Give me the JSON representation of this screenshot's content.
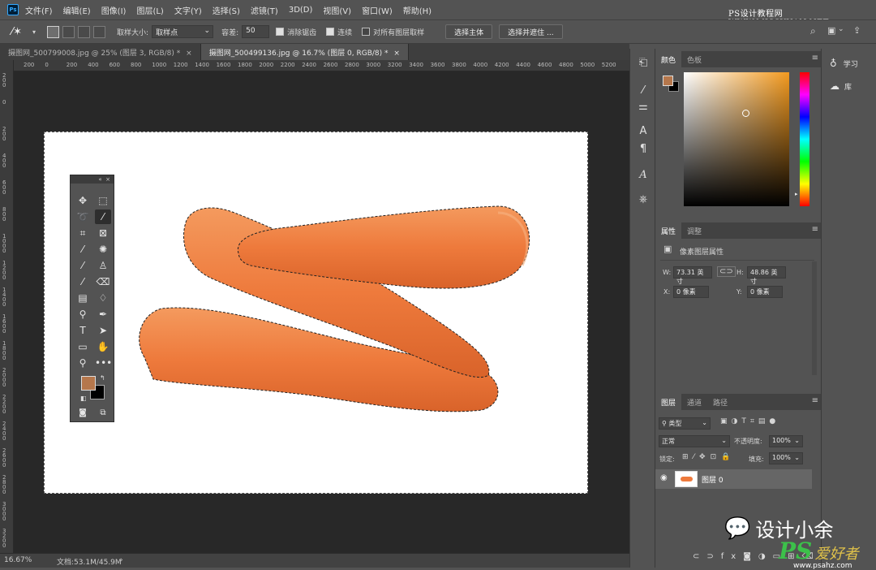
{
  "menubar": {
    "app_logo": "Ps",
    "items": [
      "文件(F)",
      "编辑(E)",
      "图像(I)",
      "图层(L)",
      "文字(Y)",
      "选择(S)",
      "滤镜(T)",
      "3D(D)",
      "视图(V)",
      "窗口(W)",
      "帮助(H)"
    ],
    "watermark": "PS设计教程网 WWW.MISSYUAN.NET"
  },
  "options": {
    "sample_size_label": "取样大小:",
    "sample_size_value": "取样点",
    "tolerance_label": "容差:",
    "tolerance_value": "50",
    "antialias_label": "消除锯齿",
    "contiguous_label": "连续",
    "all_layers_label": "对所有图层取样",
    "select_subject": "选择主体",
    "select_mask": "选择并遮住 ..."
  },
  "tabs": [
    {
      "label": "摄图网_500799008.jpg @ 25% (图层 3, RGB/8) *",
      "active": false
    },
    {
      "label": "摄图网_500499136.jpg @ 16.7% (图层 0, RGB/8) *",
      "active": true
    }
  ],
  "ruler_top": [
    "200",
    "0",
    "200",
    "400",
    "600",
    "800",
    "1000",
    "1200",
    "1400",
    "1600",
    "1800",
    "2000",
    "2200",
    "2400",
    "2600",
    "2800",
    "3000",
    "3200",
    "3400",
    "3600",
    "3800",
    "4000",
    "4200",
    "4400",
    "4600",
    "4800",
    "5000",
    "5200"
  ],
  "ruler_left": [
    "200",
    "0",
    "200",
    "400",
    "600",
    "800",
    "1000",
    "1200",
    "1400",
    "1600",
    "1800",
    "2000",
    "2200",
    "2400",
    "2600",
    "2800",
    "3000",
    "3200",
    "3400"
  ],
  "status": {
    "zoom": "16.67%",
    "doc": "文档:53.1M/45.9M"
  },
  "color_panel": {
    "tabs": [
      "颜色",
      "色板"
    ],
    "fg": "#b5774c",
    "bg": "#000000"
  },
  "props_panel": {
    "tabs": [
      "属性",
      "调整"
    ],
    "title": "像素图层属性",
    "w_label": "W:",
    "w_value": "73.31 英寸",
    "h_label": "H:",
    "h_value": "48.86 英寸",
    "x_label": "X:",
    "x_value": "0 像素",
    "y_label": "Y:",
    "y_value": "0 像素"
  },
  "layers_panel": {
    "tabs": [
      "图层",
      "通道",
      "路径"
    ],
    "filter": "类型",
    "blend": "正常",
    "opacity_label": "不透明度:",
    "opacity": "100%",
    "lock_label": "锁定:",
    "fill_label": "填充:",
    "fill": "100%",
    "layer_name": "图层 0"
  },
  "library": {
    "items": [
      "学习",
      "库"
    ]
  },
  "watermarks": {
    "wechat": "设计小余",
    "ps_brand": "PS",
    "ps_brand2": "爱好者",
    "ps_url": "www.psahz.com"
  }
}
